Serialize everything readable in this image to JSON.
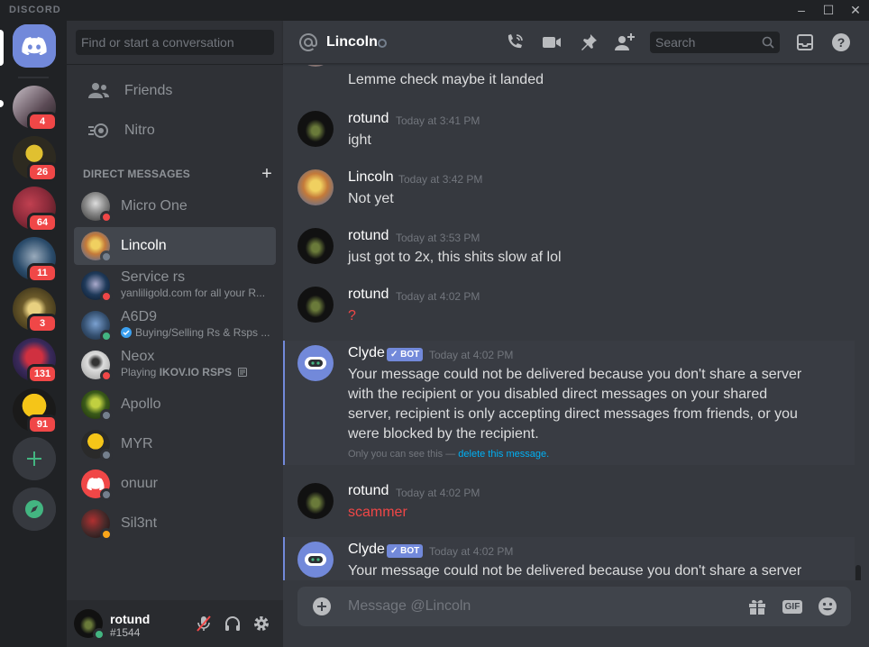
{
  "window": {
    "brand": "DISCORD",
    "controls": [
      "–",
      "☐",
      "✕"
    ]
  },
  "servers": [
    {
      "name": "server-1",
      "badge": "4",
      "color": "#5b4a55"
    },
    {
      "name": "server-2",
      "badge": "26",
      "color": "#2d2a20"
    },
    {
      "name": "server-3",
      "badge": "64",
      "color": "#8a2a3a"
    },
    {
      "name": "server-4",
      "badge": "11",
      "color": "#2b4c6b"
    },
    {
      "name": "server-5",
      "badge": "3",
      "color": "#6b5a2a"
    },
    {
      "name": "server-6",
      "badge": "131",
      "color": "#3a2a5b"
    },
    {
      "name": "server-7",
      "badge": "91",
      "color": "#c8a010"
    }
  ],
  "dm_sidebar": {
    "search_placeholder": "Find or start a conversation",
    "friends_label": "Friends",
    "nitro_label": "Nitro",
    "header": "DIRECT MESSAGES",
    "plus": "+",
    "items": [
      {
        "name": "Micro One",
        "sub": "",
        "status_color": "#f04747",
        "avatar_color": "#888"
      },
      {
        "name": "Lincoln",
        "sub": "",
        "status_color": "#747f8d",
        "avatar_color": "#c47a3a"
      },
      {
        "name": "Service rs",
        "sub": "yanliligold.com for all your R...",
        "status_color": "#f04747",
        "avatar_color": "#1f3a5a"
      },
      {
        "name": "A6D9",
        "sub": "Buying/Selling Rs & Rsps ...",
        "status_color": "#43b581",
        "avatar_color": "#355070"
      },
      {
        "name": "Neox",
        "sub_prefix": "Playing ",
        "sub_bold": "IKOV.IO RSPS",
        "status_color": "#f04747",
        "avatar_color": "#ddd"
      },
      {
        "name": "Apollo",
        "sub": "",
        "status_color": "#747f8d",
        "avatar_color": "#3a5a1a"
      },
      {
        "name": "MYR",
        "sub": "",
        "status_color": "#747f8d",
        "avatar_color": "#d4a514"
      },
      {
        "name": "onuur",
        "sub": "",
        "status_color": "#747f8d",
        "avatar_color": "#f04747"
      },
      {
        "name": "Sil3nt",
        "sub": "",
        "status_color": "#faa61a",
        "avatar_color": "#4a2a2a"
      }
    ]
  },
  "user_panel": {
    "username": "rotund",
    "tag": "#1544"
  },
  "chat": {
    "channel": "Lincoln",
    "search_placeholder": "Search",
    "messages": [
      {
        "type": "cont",
        "text": "Lemme check maybe it landed"
      },
      {
        "author": "rotund",
        "time": "Today at 3:41 PM",
        "text": "ight"
      },
      {
        "author": "Lincoln",
        "time": "Today at 3:42 PM",
        "text": "Not yet"
      },
      {
        "author": "rotund",
        "time": "Today at 3:53 PM",
        "text": "just got to 2x, this shits slow af lol"
      },
      {
        "author": "rotund",
        "time": "Today at 4:02 PM",
        "text": "?"
      },
      {
        "author": "Clyde",
        "bot": "✓ BOT",
        "time": "Today at 4:02 PM",
        "text": "Your message could not be delivered because you don't share a server with the recipient or you disabled direct messages on your shared server, recipient is only accepting direct messages from friends, or you were blocked by the recipient.",
        "note": "Only you can see this — ",
        "note_link": "delete this message."
      },
      {
        "author": "rotund",
        "time": "Today at 4:02 PM",
        "text": "scammer"
      },
      {
        "author": "Clyde",
        "bot": "✓ BOT",
        "time": "Today at 4:02 PM",
        "text": "Your message could not be delivered because you don't share a server with the recipient or you disabled direct messages on your shared server,"
      }
    ],
    "composer_placeholder": "Message @Lincoln",
    "gif_label": "GIF"
  }
}
